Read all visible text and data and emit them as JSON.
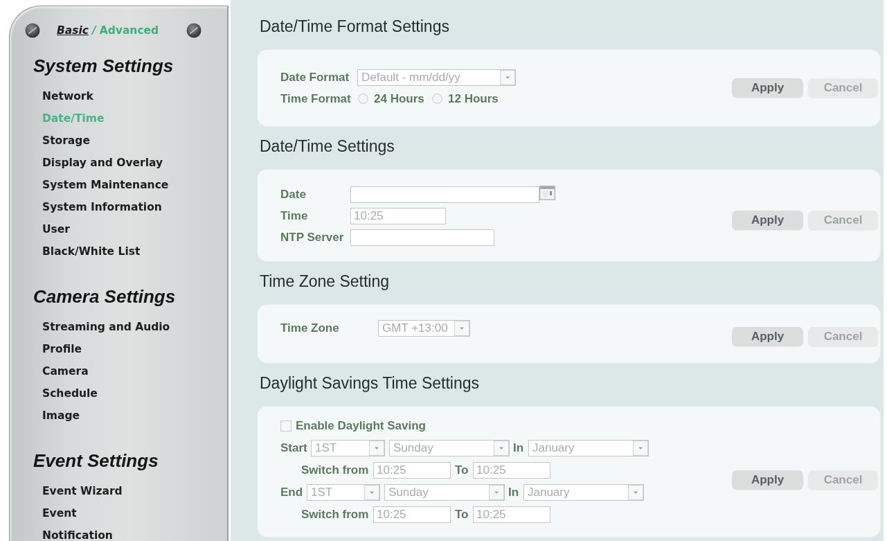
{
  "sidebar": {
    "mode_switch": [
      {
        "label": "Basic",
        "selected": false
      },
      {
        "label": "Advanced",
        "selected": true
      }
    ],
    "separator": "/",
    "groups": [
      {
        "title": "System Settings",
        "items": [
          {
            "label": "Network",
            "selected": false
          },
          {
            "label": "Date/Time",
            "selected": true
          },
          {
            "label": "Storage",
            "selected": false
          },
          {
            "label": "Display and Overlay",
            "selected": false
          },
          {
            "label": "System Maintenance",
            "selected": false
          },
          {
            "label": "System Information",
            "selected": false
          },
          {
            "label": "User",
            "selected": false
          },
          {
            "label": "Black/White List",
            "selected": false
          }
        ]
      },
      {
        "title": "Camera Settings",
        "items": [
          {
            "label": "Streaming and Audio",
            "selected": false
          },
          {
            "label": "Profile",
            "selected": false
          },
          {
            "label": "Camera",
            "selected": false
          },
          {
            "label": "Schedule",
            "selected": false
          },
          {
            "label": "Image",
            "selected": false
          }
        ]
      },
      {
        "title": "Event Settings",
        "items": [
          {
            "label": "Event Wizard",
            "selected": false
          },
          {
            "label": "Event",
            "selected": false
          },
          {
            "label": "Notification",
            "selected": false
          }
        ]
      }
    ]
  },
  "sections": [
    {
      "title": "Date/Time Format Settings",
      "rows": [
        {
          "fields": [
            {
              "kind": "label",
              "text": "Date Format"
            },
            {
              "kind": "select",
              "value": "Default - mm/dd/yy"
            }
          ]
        },
        {
          "fields": [
            {
              "kind": "label",
              "text": "Time Format"
            },
            {
              "kind": "radio",
              "label": "24 Hours",
              "selected": false
            },
            {
              "kind": "radio",
              "label": "12 Hours",
              "selected": false
            }
          ]
        }
      ],
      "buttons": [
        {
          "label": "Apply",
          "disabled": false
        },
        {
          "label": "Cancel",
          "disabled": true
        }
      ]
    },
    {
      "title": "Date/Time Settings",
      "rows": [
        {
          "fields": [
            {
              "kind": "label",
              "text": "Date"
            },
            {
              "kind": "date_input"
            }
          ]
        },
        {
          "fields": [
            {
              "kind": "label",
              "text": "Time"
            },
            {
              "kind": "text_input",
              "value": "10:25"
            }
          ]
        },
        {
          "fields": [
            {
              "kind": "label",
              "text": "NTP Server"
            },
            {
              "kind": "text_input"
            }
          ]
        }
      ],
      "buttons": [
        {
          "label": "Apply",
          "disabled": false
        },
        {
          "label": "Cancel",
          "disabled": true
        }
      ]
    },
    {
      "title": "Time Zone Setting",
      "rows": [
        {
          "fields": [
            {
              "kind": "label",
              "text": "Time Zone"
            },
            {
              "kind": "select",
              "value": "GMT +13:00"
            }
          ]
        }
      ],
      "buttons": [
        {
          "label": "Apply",
          "disabled": false
        },
        {
          "label": "Cancel",
          "disabled": true
        }
      ]
    },
    {
      "title": "Daylight Savings Time Settings",
      "rows": [
        {
          "fields": [
            {
              "kind": "checkbox",
              "label": "Enable Daylight Saving",
              "checked": false
            }
          ]
        },
        {
          "fields": [
            {
              "kind": "label",
              "text": "Start"
            },
            {
              "kind": "select",
              "value": "1ST"
            },
            {
              "kind": "select",
              "value": "Sunday"
            },
            {
              "kind": "label",
              "text": "In"
            },
            {
              "kind": "select",
              "value": "January"
            }
          ]
        },
        {
          "fields": [
            {
              "kind": "label",
              "text": "Switch from"
            },
            {
              "kind": "text_input",
              "value": "10:25"
            },
            {
              "kind": "label",
              "text": "To"
            },
            {
              "kind": "text_input",
              "value": "10:25"
            }
          ]
        },
        {
          "fields": [
            {
              "kind": "label",
              "text": "End"
            },
            {
              "kind": "select",
              "value": "1ST"
            },
            {
              "kind": "select",
              "value": "Sunday"
            },
            {
              "kind": "label",
              "text": "In"
            },
            {
              "kind": "select",
              "value": "January"
            }
          ]
        },
        {
          "fields": [
            {
              "kind": "label",
              "text": "Switch from"
            },
            {
              "kind": "text_input",
              "value": "10:25"
            },
            {
              "kind": "label",
              "text": "To"
            },
            {
              "kind": "text_input",
              "value": "10:25"
            }
          ]
        }
      ],
      "buttons": [
        {
          "label": "Apply",
          "disabled": false
        },
        {
          "label": "Cancel",
          "disabled": true
        }
      ]
    }
  ]
}
